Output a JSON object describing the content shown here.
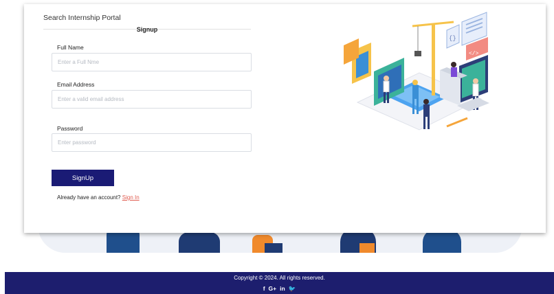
{
  "header": {
    "portal_title": "Search Internship Portal"
  },
  "form": {
    "heading": "Signup",
    "full_name": {
      "label": "Full Name",
      "placeholder": "Enter a Full Nme",
      "value": ""
    },
    "email": {
      "label": "Email Address",
      "placeholder": "Enter a valid email address",
      "value": ""
    },
    "password": {
      "label": "Password",
      "placeholder": "Enter password",
      "value": ""
    },
    "submit_label": "SignUp",
    "account_prompt": "Already have an account?",
    "signin_label": "Sign In"
  },
  "footer": {
    "copyright": "Copyright © 2024. All rights reserved.",
    "social": {
      "facebook": "f",
      "google_plus": "G+",
      "linkedin": "in",
      "twitter": "🐦"
    }
  },
  "colors": {
    "primary": "#1a1b75",
    "footer_bg": "#1d1e6e",
    "link": "#e05a4e"
  }
}
